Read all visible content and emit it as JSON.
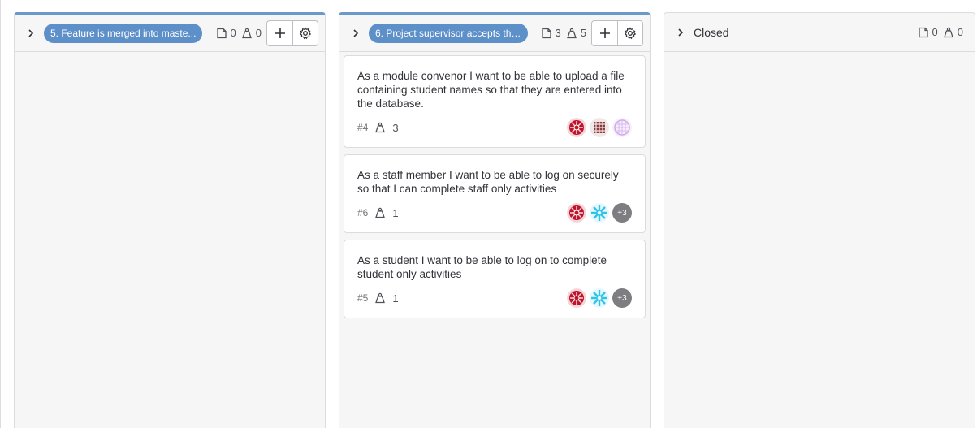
{
  "lists": [
    {
      "label": "5. Feature is merged into maste...",
      "issue_count": "0",
      "weight_count": "0",
      "color": "#5d8fc9",
      "cards": []
    },
    {
      "label": "6. Project supervisor accepts the...",
      "issue_count": "3",
      "weight_count": "5",
      "color": "#5d8fc9",
      "cards": [
        {
          "title": "As a module convenor I want to be able to upload a file containing student names so that they are entered into the database.",
          "number": "#4",
          "weight": "3",
          "avatars": [
            "red-pattern",
            "brown-pattern",
            "lavender-pattern"
          ]
        },
        {
          "title": "As a staff member I want to be able to log on securely so that I can complete staff only activities",
          "number": "#6",
          "weight": "1",
          "avatars": [
            "red-pattern",
            "cyan-pattern"
          ],
          "more": "+3"
        },
        {
          "title": "As a student I want to be able to log on to complete student only activities",
          "number": "#5",
          "weight": "1",
          "avatars": [
            "red-pattern",
            "cyan-pattern"
          ],
          "more": "+3"
        }
      ]
    },
    {
      "title": "Closed",
      "issue_count": "0",
      "weight_count": "0",
      "cards": []
    }
  ],
  "icons": {
    "collapse": "chevron-right-icon",
    "issues": "issues-icon",
    "weight": "weight-icon",
    "add": "plus-icon",
    "settings": "gear-icon"
  }
}
